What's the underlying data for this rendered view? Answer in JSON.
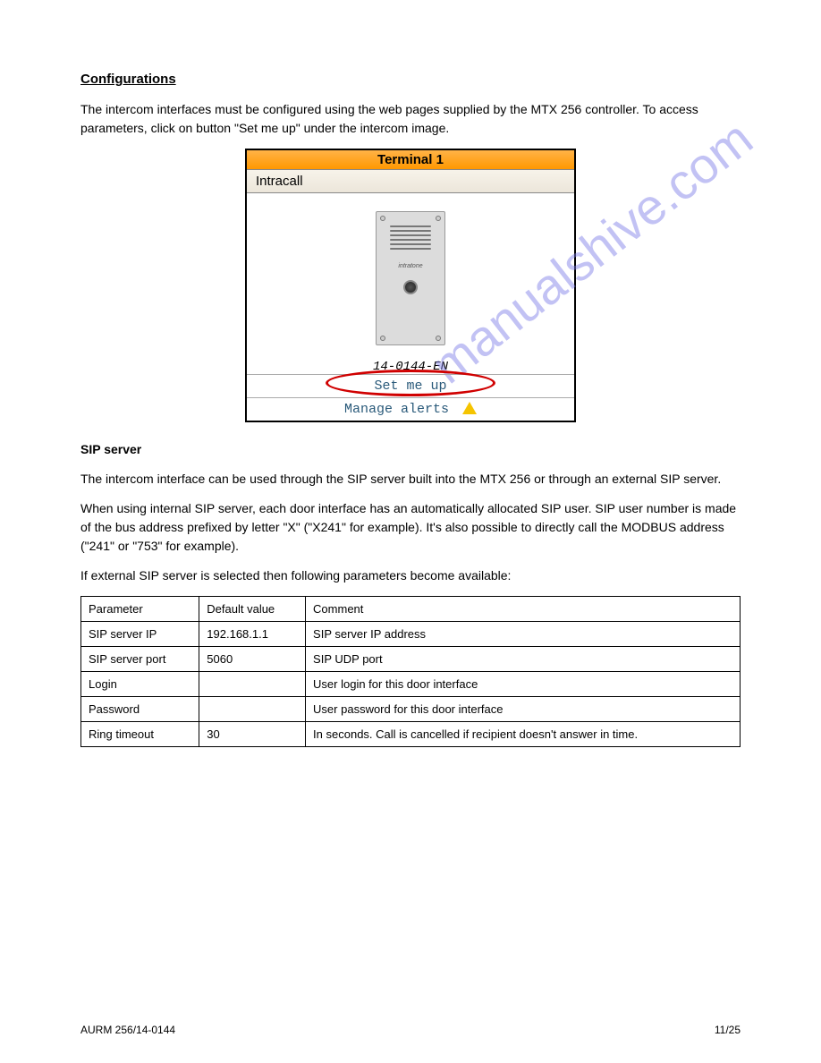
{
  "watermark": "manualshive.com",
  "section": {
    "heading": "Configurations",
    "intro": "The intercom interfaces must be configured using the web pages supplied by the MTX 256 controller. To access parameters, click on button \"Set me up\" under the intercom image."
  },
  "figure": {
    "titlebar": "Terminal 1",
    "band": "Intracall",
    "model": "14-0144-EN",
    "setmeup": "Set me up",
    "alerts": "Manage alerts"
  },
  "sip": {
    "title": "SIP server",
    "p1": "The intercom interface can be used through the SIP server built into the MTX 256 or through an external SIP server.",
    "p2": "When using internal SIP server, each door interface has an automatically allocated SIP user. SIP user number is made of the bus address prefixed by letter \"X\" (\"X241\" for example). It's also possible to directly call the MODBUS address (\"241\" or \"753\" for example)."
  },
  "external": {
    "intro": "If external SIP server is selected then following parameters become available:",
    "table": [
      {
        "p": "Parameter",
        "d": "Default value",
        "c": "Comment"
      },
      {
        "p": "SIP server IP",
        "d": "192.168.1.1",
        "c": "SIP server IP address"
      },
      {
        "p": "SIP server port",
        "d": "5060",
        "c": "SIP UDP port"
      },
      {
        "p": "Login",
        "d": "",
        "c": "User login for this door interface"
      },
      {
        "p": "Password",
        "d": "",
        "c": "User password for this door interface"
      },
      {
        "p": "Ring timeout",
        "d": "30",
        "c": "In seconds. Call is cancelled if recipient doesn't answer in time."
      }
    ]
  },
  "footer": {
    "product": "AURM 256/14-0144",
    "pages": "11/25"
  }
}
